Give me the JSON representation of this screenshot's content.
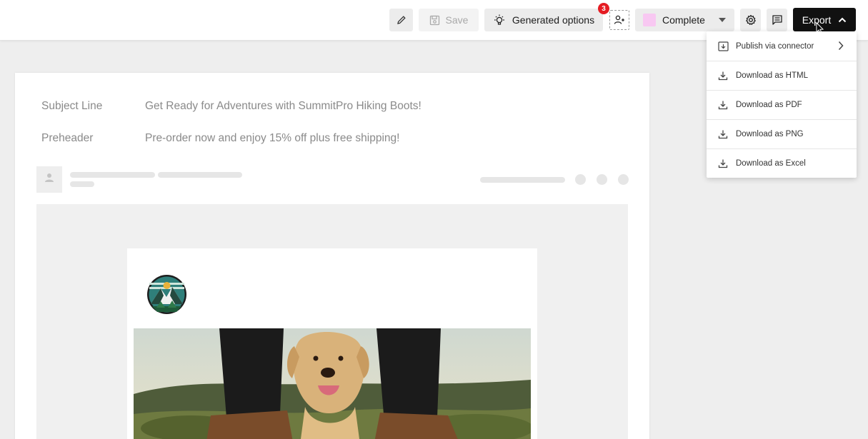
{
  "toolbar": {
    "edit_icon": "pencil-icon",
    "save_label": "Save",
    "generated_label": "Generated options",
    "generated_badge": "3",
    "add_user_icon": "add-user-icon",
    "status_label": "Complete",
    "status_color": "#f8c8f2",
    "settings_icon": "gear-icon",
    "comment_icon": "comment-icon",
    "export_label": "Export",
    "export_color": "#111111"
  },
  "export_menu": {
    "items": [
      {
        "label": "Publish via connector",
        "icon": "upload-icon"
      },
      {
        "label": "Download as HTML",
        "icon": "download-icon"
      },
      {
        "label": "Download as PDF",
        "icon": "download-icon"
      },
      {
        "label": "Download as PNG",
        "icon": "download-icon"
      },
      {
        "label": "Download as Excel",
        "icon": "download-icon"
      }
    ]
  },
  "email": {
    "subject_label": "Subject Line",
    "subject_value": "Get Ready for Adventures with SummitPro Hiking Boots!",
    "preheader_label": "Preheader",
    "preheader_value": "Pre-order now and enjoy 15% off plus free shipping!"
  },
  "colors": {
    "accent_badge": "#e51c23",
    "topbar_bg": "#ffffff",
    "canvas_bg": "#eeeeee"
  }
}
